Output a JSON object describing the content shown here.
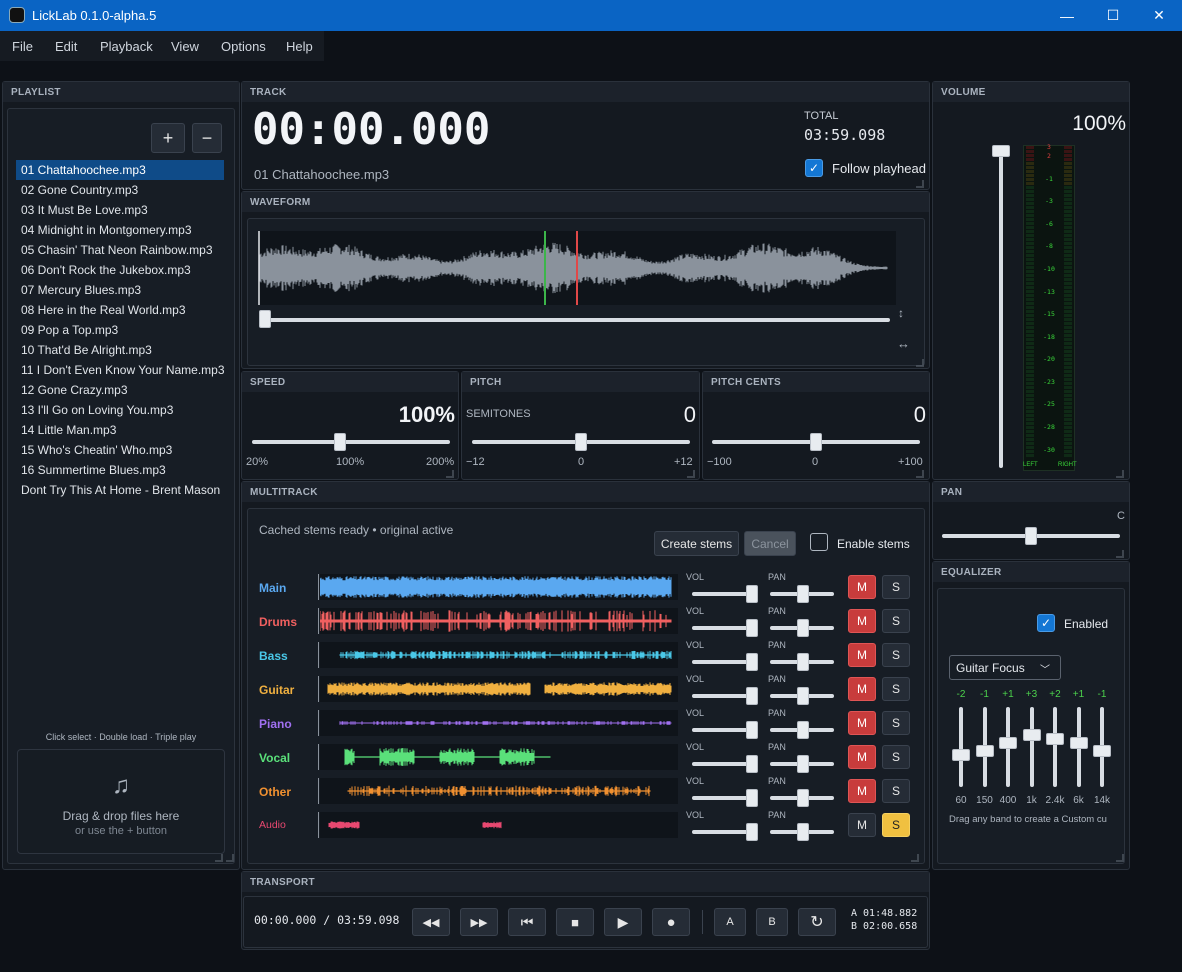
{
  "window": {
    "title": "LickLab 0.1.0-alpha.5",
    "minimize": "—",
    "maximize": "☐",
    "close": "✕"
  },
  "menu": [
    "File",
    "Edit",
    "Playback",
    "View",
    "Options",
    "Help"
  ],
  "playlist": {
    "header": "PLAYLIST",
    "add": "+",
    "remove": "−",
    "items": [
      "01 Chattahoochee.mp3",
      "02 Gone Country.mp3",
      "03 It Must Be Love.mp3",
      "04 Midnight in Montgomery.mp3",
      "05 Chasin' That Neon Rainbow.mp3",
      "06 Don't Rock the Jukebox.mp3",
      "07 Mercury Blues.mp3",
      "08 Here in the Real World.mp3",
      "09 Pop a Top.mp3",
      "10 That'd Be Alright.mp3",
      "11 I Don't Even Know Your Name.mp3",
      "12 Gone Crazy.mp3",
      "13 I'll Go on Loving You.mp3",
      "14 Little Man.mp3",
      "15 Who's Cheatin' Who.mp3",
      "16 Summertime Blues.mp3",
      "Dont Try This At Home - Brent Mason"
    ],
    "selected": 0,
    "hint": "Click select · Double load · Triple play",
    "drop_icon": "♫",
    "drop_title": "Drag & drop files here",
    "drop_sub": "or use the + button"
  },
  "track": {
    "header": "TRACK",
    "time": "00:00.000",
    "total_label": "TOTAL",
    "total": "03:59.098",
    "filename": "01 Chattahoochee.mp3",
    "follow_label": "Follow playhead",
    "follow": true
  },
  "waveform": {
    "header": "WAVEFORM",
    "v_icon": "↕",
    "h_icon": "↔",
    "marker_a_frac": 0.45,
    "marker_b_frac": 0.5,
    "position_frac": 0
  },
  "speed": {
    "header": "SPEED",
    "value": "100%",
    "min": "20%",
    "mid": "100%",
    "max": "200%",
    "frac": 0.45
  },
  "pitch": {
    "header": "PITCH",
    "label": "SEMITONES",
    "value": "0",
    "min": "−12",
    "mid": "0",
    "max": "+12",
    "frac": 0.5
  },
  "cents": {
    "header": "PITCH CENTS",
    "value": "0",
    "min": "−100",
    "mid": "0",
    "max": "+100",
    "frac": 0.5
  },
  "volume": {
    "header": "VOLUME",
    "value": "100%",
    "frac": 1.0,
    "scale": [
      "3",
      "2",
      "-1",
      "-3",
      "-6",
      "-8",
      "-10",
      "-13",
      "-15",
      "-18",
      "-20",
      "-23",
      "-25",
      "-28",
      "-30"
    ],
    "left": "LEFT",
    "right": "RIGHT"
  },
  "pan": {
    "header": "PAN",
    "value": "C",
    "frac": 0.5
  },
  "multitrack": {
    "header": "MULTITRACK",
    "status": "Cached stems ready • original active",
    "create": "Create stems",
    "cancel": "Cancel",
    "enable_label": "Enable stems",
    "enable": false,
    "vol_label": "VOL",
    "pan_label": "PAN",
    "mute": "M",
    "solo": "S",
    "stems": [
      {
        "name": "Main",
        "color": "#5aa8f0",
        "muted": true,
        "solo": false
      },
      {
        "name": "Drums",
        "color": "#f06060",
        "muted": true,
        "solo": false
      },
      {
        "name": "Bass",
        "color": "#4ac8e8",
        "muted": true,
        "solo": false
      },
      {
        "name": "Guitar",
        "color": "#f0b040",
        "muted": true,
        "solo": false
      },
      {
        "name": "Piano",
        "color": "#a070f0",
        "muted": true,
        "solo": false
      },
      {
        "name": "Vocal",
        "color": "#5ae07a",
        "muted": true,
        "solo": false
      },
      {
        "name": "Other",
        "color": "#f09030",
        "muted": true,
        "solo": false
      },
      {
        "name": "Audio",
        "color": "#e84870",
        "muted": false,
        "solo": true
      }
    ]
  },
  "equalizer": {
    "header": "EQUALIZER",
    "enabled_label": "Enabled",
    "enabled": true,
    "preset": "Guitar Focus",
    "bands": [
      {
        "f": "60",
        "g": "-2"
      },
      {
        "f": "150",
        "g": "-1"
      },
      {
        "f": "400",
        "g": "+1"
      },
      {
        "f": "1k",
        "g": "+3"
      },
      {
        "f": "2.4k",
        "g": "+2"
      },
      {
        "f": "6k",
        "g": "+1"
      },
      {
        "f": "14k",
        "g": "-1"
      }
    ],
    "hint": "Drag any band to create a Custom cu"
  },
  "transport": {
    "header": "TRANSPORT",
    "time": "00:00.000 / 03:59.098",
    "a_label": "A",
    "b_label": "B",
    "a_time": "A 01:48.882",
    "b_time": "B 02:00.658"
  },
  "colors": {
    "accent": "#1477d4",
    "waveform": "#8a929c",
    "marker_a": "#3cb54a",
    "marker_b": "#e04848"
  }
}
